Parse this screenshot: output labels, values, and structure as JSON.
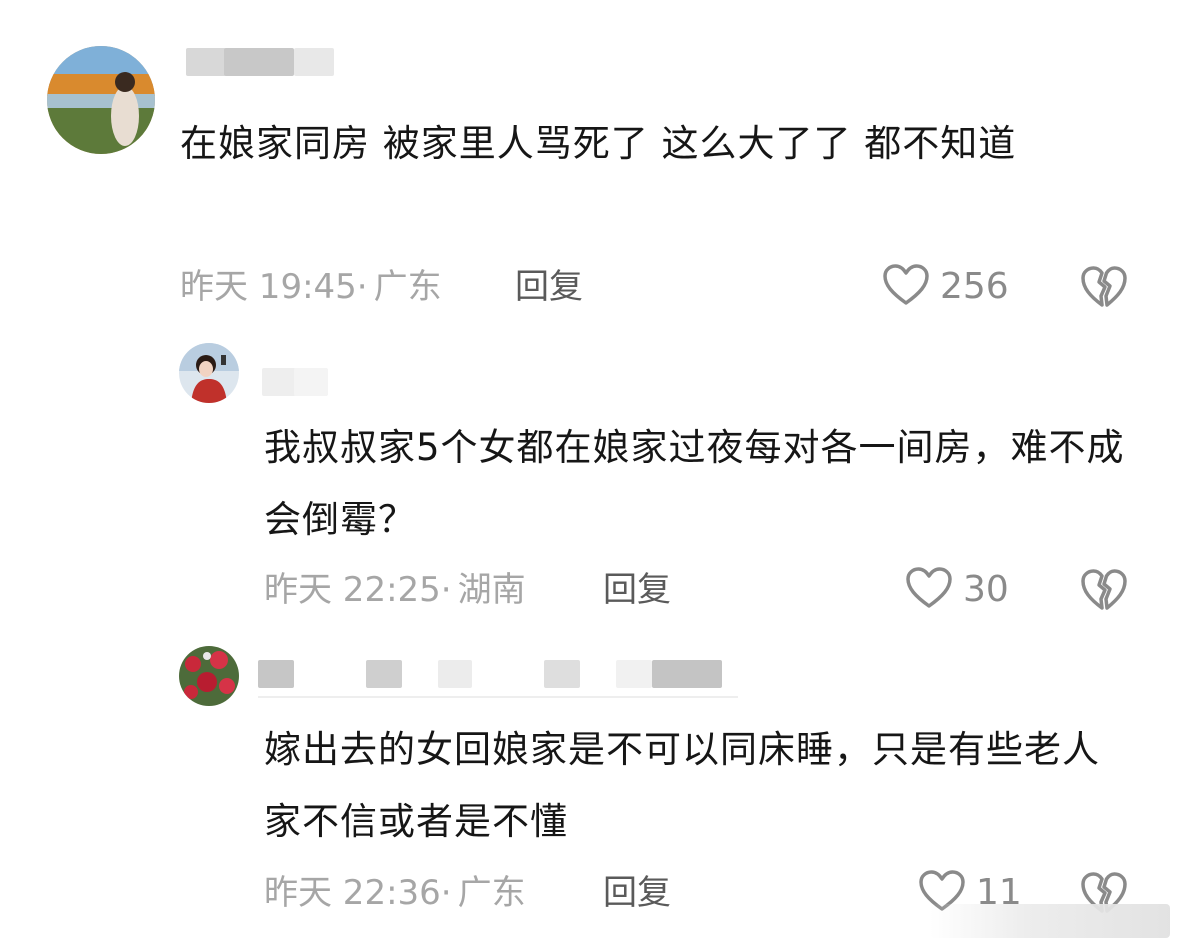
{
  "comments": [
    {
      "text": "在娘家同房 被家里人骂死了  这么大了了  都不知道",
      "time": "昨天 19:45",
      "location": "广东",
      "reply_label": "回复",
      "likes": "256"
    },
    {
      "text": "我叔叔家5个女都在娘家过夜每对各一间房，难不成会倒霉？",
      "time": "昨天 22:25",
      "location": "湖南",
      "reply_label": "回复",
      "likes": "30"
    },
    {
      "text": "嫁出去的女回娘家是不可以同床睡，只是有些老人家不信或者是不懂",
      "time": "昨天 22:36",
      "location": "广东",
      "reply_label": "回复",
      "likes": "11"
    }
  ],
  "separator": "·",
  "icons": {
    "like": "heart-outline-icon",
    "dislike": "broken-heart-icon"
  },
  "colors": {
    "text": "#161616",
    "meta": "#a6a6a6",
    "reply": "#5a5a5a",
    "icon": "#8a8a8a"
  }
}
